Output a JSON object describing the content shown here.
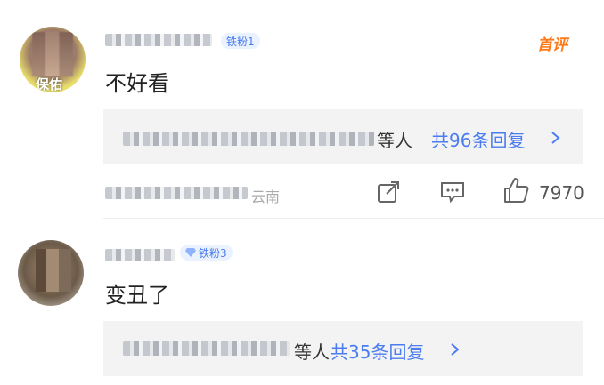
{
  "comments": [
    {
      "badge_label": "铁粉1",
      "first_badge": "首评",
      "text": "不好看",
      "reply_suffix": "等人",
      "reply_link": "共96条回复",
      "meta_suffix": "云南",
      "likes": "7970",
      "avatar_tag": "保佑"
    },
    {
      "badge_label": "铁粉3",
      "text": "变丑了",
      "reply_suffix": "等人",
      "reply_link": "共35条回复"
    }
  ],
  "icons": {
    "share": "share-icon",
    "comment": "comment-icon",
    "like": "like-icon",
    "diamond": "diamond-icon",
    "chevron": "chevron-right-icon"
  }
}
